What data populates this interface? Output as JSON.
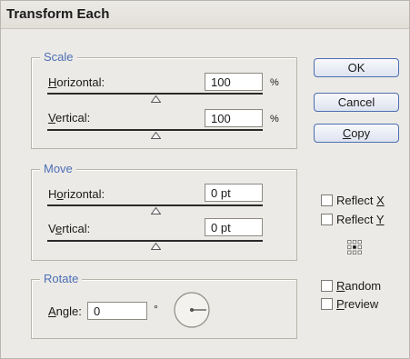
{
  "dialog": {
    "title": "Transform Each"
  },
  "scale": {
    "legend": "Scale",
    "horizontal": {
      "label": "Horizontal:",
      "value": "100",
      "unit": "%",
      "slider_fraction": 0.5
    },
    "vertical": {
      "label": "Vertical:",
      "value": "100",
      "unit": "%",
      "slider_fraction": 0.5
    }
  },
  "move": {
    "legend": "Move",
    "horizontal": {
      "label": "Horizontal:",
      "value": "0 pt",
      "slider_fraction": 0.5
    },
    "vertical": {
      "label": "Vertical:",
      "value": "0 pt",
      "slider_fraction": 0.5
    }
  },
  "rotate": {
    "legend": "Rotate",
    "angle_label": "Angle:",
    "angle_value": "0",
    "degree_symbol": "°",
    "dial_angle_degrees": 0
  },
  "buttons": {
    "ok": "OK",
    "cancel": "Cancel",
    "copy": "Copy"
  },
  "options": {
    "reflect_x": {
      "label": "Reflect X",
      "checked": false
    },
    "reflect_y": {
      "label": "Reflect Y",
      "checked": false
    },
    "random": {
      "label": "Random",
      "checked": false
    },
    "preview": {
      "label": "Preview",
      "checked": false
    }
  },
  "reference_point": {
    "selected": "center"
  },
  "colors": {
    "accent": "#4b6fb5",
    "panel": "#eceae6",
    "button_border": "#4c6fb0"
  }
}
